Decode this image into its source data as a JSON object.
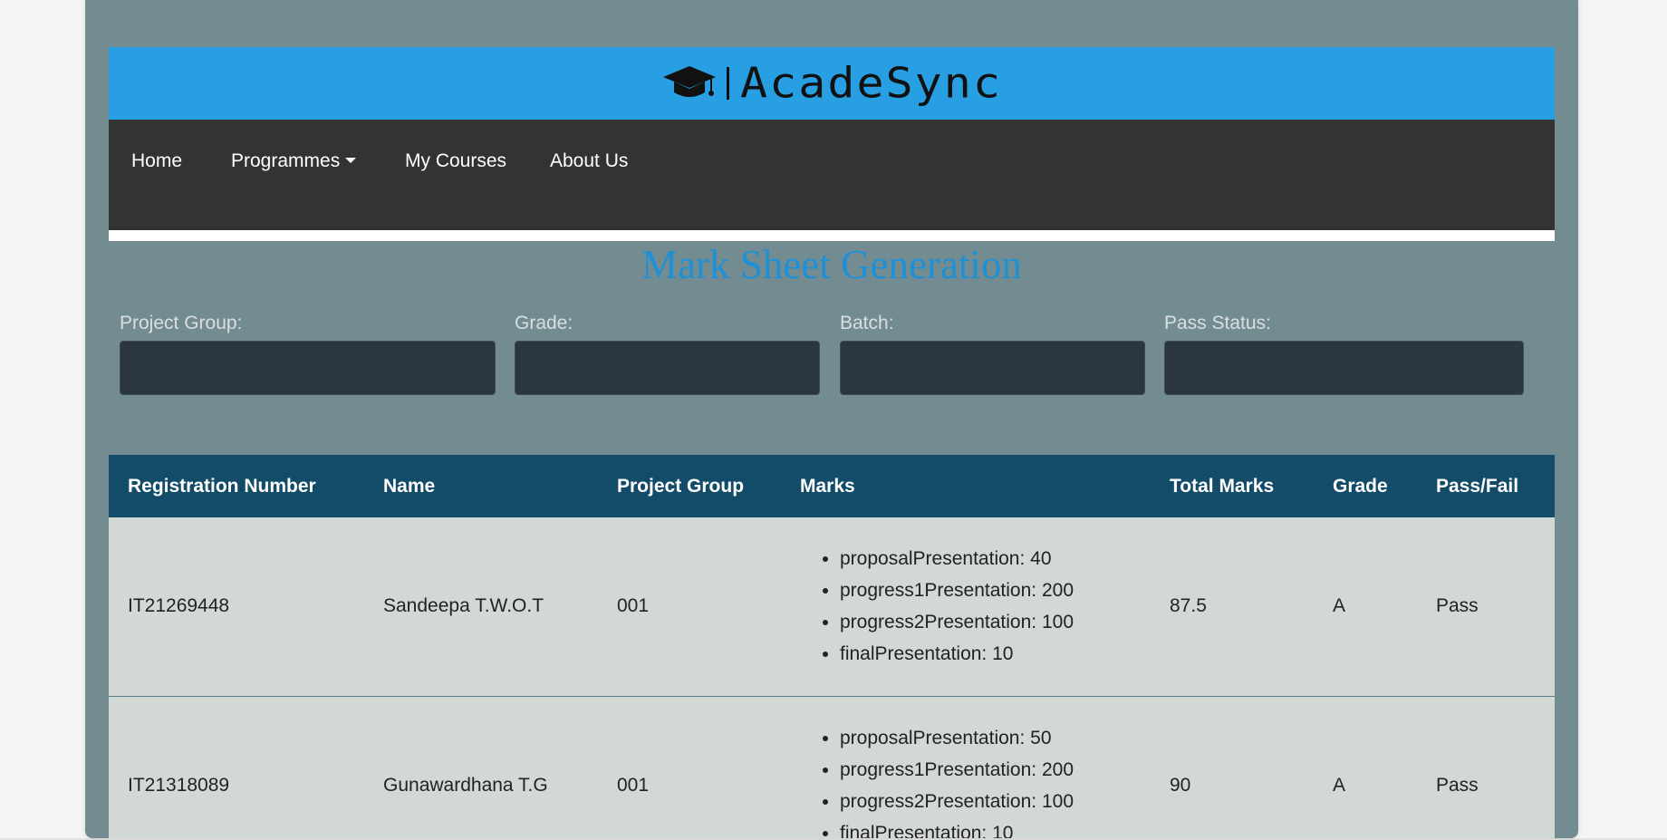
{
  "header": {
    "brand_name": "AcadeSync",
    "logo_icon": "graduation-cap-icon"
  },
  "nav": {
    "items": [
      {
        "label": "Home"
      },
      {
        "label": "Programmes",
        "has_dropdown": true
      },
      {
        "label": "My Courses"
      },
      {
        "label": "About Us"
      }
    ]
  },
  "page": {
    "title": "Mark Sheet Generation"
  },
  "filters": {
    "project_group": {
      "label": "Project Group:",
      "value": ""
    },
    "grade": {
      "label": "Grade:",
      "value": ""
    },
    "batch": {
      "label": "Batch:",
      "value": ""
    },
    "pass_status": {
      "label": "Pass Status:",
      "value": ""
    }
  },
  "table": {
    "columns": [
      "Registration Number",
      "Name",
      "Project Group",
      "Marks",
      "Total Marks",
      "Grade",
      "Pass/Fail"
    ],
    "rows": [
      {
        "registration_number": "IT21269448",
        "name": "Sandeepa T.W.O.T",
        "project_group": "001",
        "marks": [
          "proposalPresentation: 40",
          "progress1Presentation: 200",
          "progress2Presentation: 100",
          "finalPresentation: 10"
        ],
        "total_marks": "87.5",
        "grade": "A",
        "pass_fail": "Pass"
      },
      {
        "registration_number": "IT21318089",
        "name": "Gunawardhana T.G",
        "project_group": "001",
        "marks": [
          "proposalPresentation: 50",
          "progress1Presentation: 200",
          "progress2Presentation: 100",
          "finalPresentation: 10"
        ],
        "total_marks": "90",
        "grade": "A",
        "pass_fail": "Pass"
      }
    ]
  },
  "colors": {
    "card_background": "#738c91",
    "brand_bar": "#279fe2",
    "navbar": "#333333",
    "title_blue": "#1e90d6",
    "table_header": "#134c69",
    "table_row": "#d2d9d4",
    "input_background": "#2c3641"
  }
}
